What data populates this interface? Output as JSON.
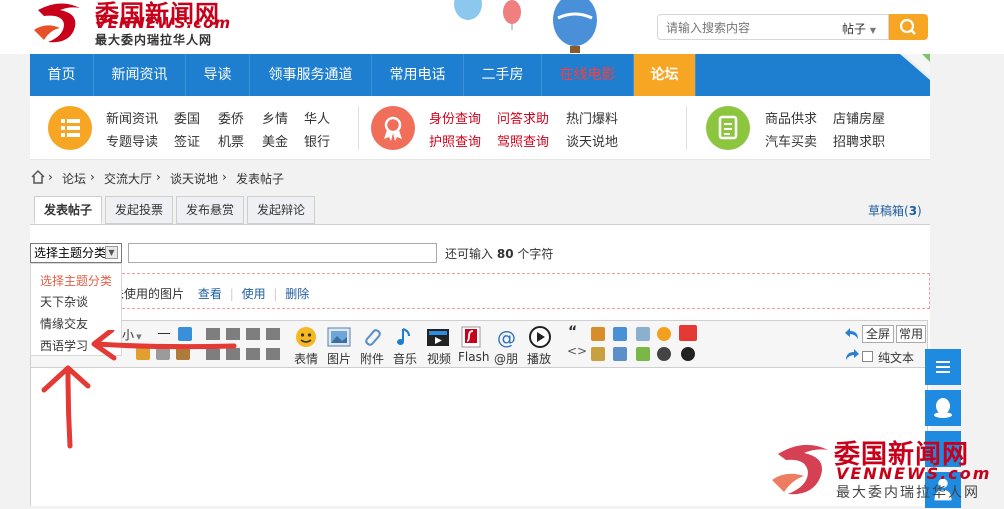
{
  "header": {
    "logo_cn": "委国新闻网",
    "logo_en": "VENNEWS.com",
    "logo_tag": "最大委内瑞拉华人网",
    "search": {
      "placeholder": "请输入搜索内容",
      "type": "帖子"
    }
  },
  "nav": {
    "items": [
      {
        "label": "首页"
      },
      {
        "label": "新闻资讯"
      },
      {
        "label": "导读"
      },
      {
        "label": "领事服务通道"
      },
      {
        "label": "常用电话"
      },
      {
        "label": "二手房"
      },
      {
        "label": "在线电影"
      },
      {
        "label": "论坛"
      }
    ]
  },
  "subnav": {
    "group1": [
      "新闻资讯",
      "委国",
      "委侨",
      "乡情",
      "华人",
      "专题导读",
      "签证",
      "机票",
      "美金",
      "银行"
    ],
    "group2": [
      "身份查询",
      "问答求助",
      "热门爆料",
      "护照查询",
      "驾照查询",
      "谈天说地"
    ],
    "group3": [
      "商品供求",
      "店铺房屋",
      "汽车买卖",
      "招聘求职"
    ],
    "colors": {
      "orange": "#f6a623",
      "coral": "#f06e5a",
      "green": "#8cc63f"
    }
  },
  "breadcrumb": [
    "论坛",
    "交流大厅",
    "谈天说地",
    "发表帖子"
  ],
  "tabs": [
    {
      "label": "发表帖子"
    },
    {
      "label": "发起投票"
    },
    {
      "label": "发布悬赏"
    },
    {
      "label": "发起辩论"
    }
  ],
  "drafts": {
    "label": "草稿箱(",
    "count": "3",
    "close": ")"
  },
  "form": {
    "category_select": "选择主题分类",
    "char_prefix": "还可输入",
    "char_count": "80",
    "char_suffix": "个字符",
    "images_text": "未使用的图片",
    "view": "查看",
    "use": "使用",
    "delete": "删除"
  },
  "dropdown": {
    "options": [
      "选择主题分类",
      "天下杂谈",
      "情缘交友",
      "西语学习"
    ]
  },
  "toolbar": {
    "font_size": "小",
    "tools": [
      "表情",
      "图片",
      "附件",
      "音乐",
      "视频",
      "Flash",
      "@朋",
      "播放"
    ],
    "fullscreen": "全屏",
    "common": "常用",
    "plain_text": "纯文本"
  },
  "watermark": {
    "cn": "委国新闻网",
    "en": "VENNEWS.com",
    "tag": "最大委内瑞拉华人网"
  },
  "accent": {
    "blue": "#1e7ecf",
    "orange": "#f6a623",
    "red": "#e53935"
  }
}
